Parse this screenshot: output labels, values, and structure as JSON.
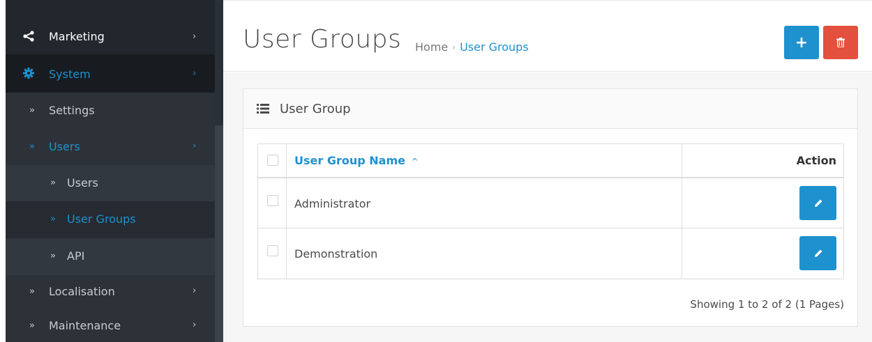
{
  "sidebar": {
    "items": [
      {
        "label": "Marketing"
      },
      {
        "label": "System"
      },
      {
        "label": "Settings"
      },
      {
        "label": "Users"
      },
      {
        "label": "Users"
      },
      {
        "label": "User Groups"
      },
      {
        "label": "API"
      },
      {
        "label": "Localisation"
      },
      {
        "label": "Maintenance"
      }
    ],
    "chevron": "›",
    "double_chevron": "»"
  },
  "header": {
    "title": "User Groups",
    "breadcrumb": {
      "home": "Home",
      "separator": "›",
      "current": "User Groups"
    },
    "add_button_glyph": "+"
  },
  "panel": {
    "title": "User Group"
  },
  "table": {
    "columns": {
      "name": "User Group Name",
      "sort_indicator": "^",
      "action": "Action"
    },
    "rows": [
      {
        "name": "Administrator"
      },
      {
        "name": "Demonstration"
      }
    ]
  },
  "pagination": {
    "text": "Showing 1 to 2 of 2 (1 Pages)"
  },
  "colors": {
    "accent": "#1e91cf",
    "danger": "#e3503e",
    "sidebar_bg": "#2a3037"
  },
  "icons": {
    "marketing": "share-icon",
    "system": "gear-icon",
    "panel": "list-icon",
    "add": "plus-icon",
    "delete": "trash-icon",
    "edit": "pencil-icon"
  }
}
